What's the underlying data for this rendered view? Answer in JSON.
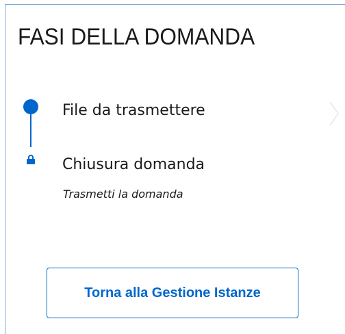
{
  "panel": {
    "title": "FASI DELLA DOMANDA"
  },
  "steps": [
    {
      "label": "File da trasmettere",
      "status": "current",
      "icon": "filled-circle-icon"
    },
    {
      "label": "Chiusura domanda",
      "status": "locked",
      "icon": "lock-icon",
      "sublabel": "Trasmetti la domanda"
    }
  ],
  "actions": {
    "back_label": "Torna alla Gestione Istanze"
  },
  "colors": {
    "accent": "#0066cc",
    "text": "#1a1a1a",
    "panel_border": "#7fa8d6"
  }
}
